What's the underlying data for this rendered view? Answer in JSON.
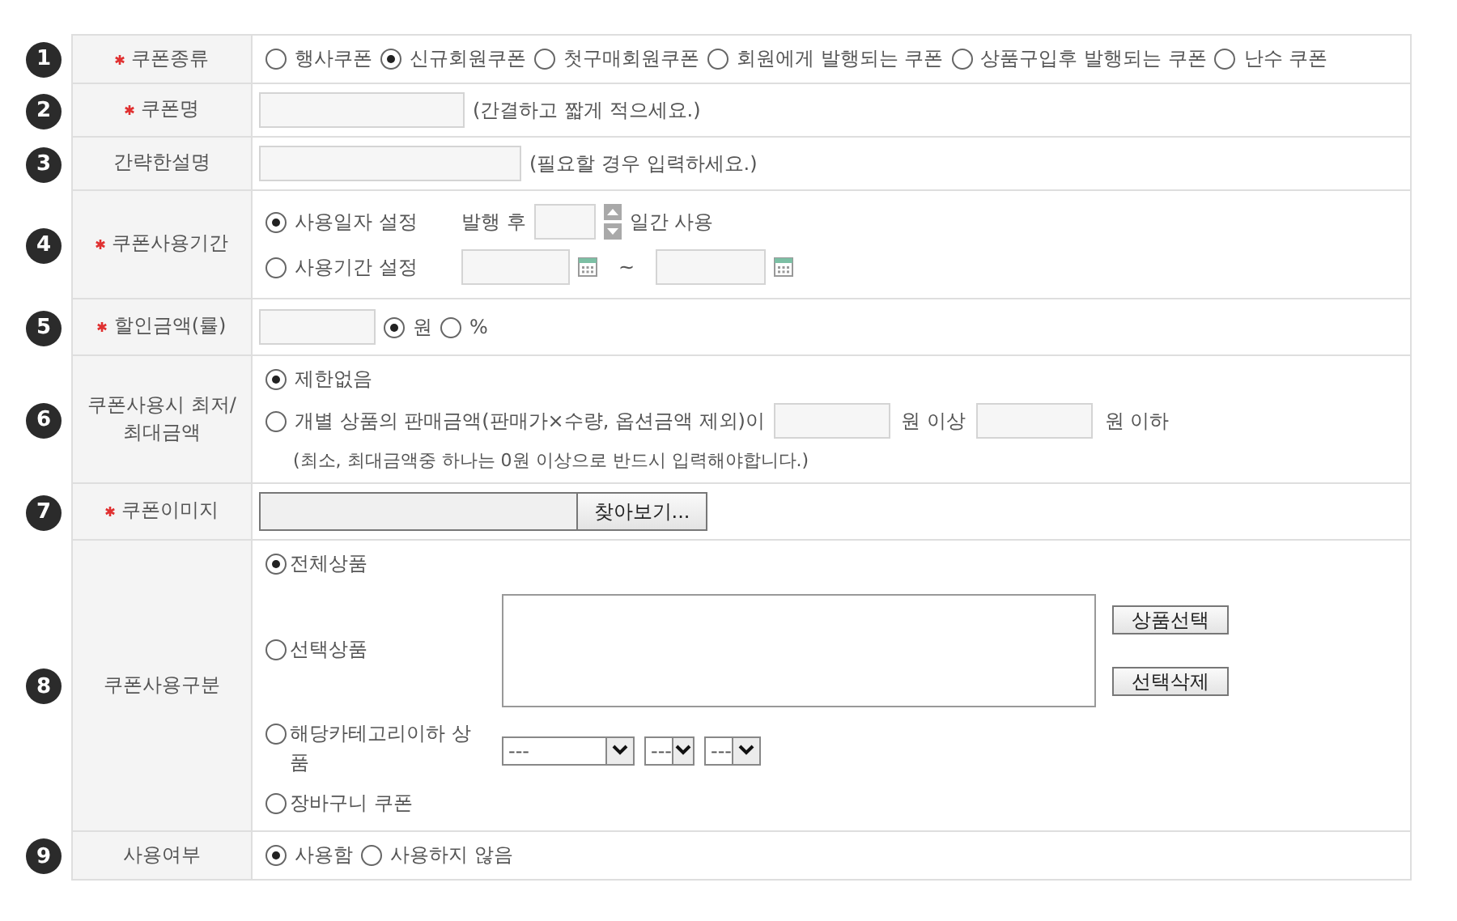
{
  "rows": [
    {
      "number": "1",
      "label": "쿠폰종류",
      "required": true,
      "kind": "radios",
      "options": [
        {
          "label": "행사쿠폰",
          "selected": false
        },
        {
          "label": "신규회원쿠폰",
          "selected": true
        },
        {
          "label": "첫구매회원쿠폰",
          "selected": false
        },
        {
          "label": "회원에게 발행되는 쿠폰",
          "selected": false
        },
        {
          "label": "상품구입후 발행되는 쿠폰",
          "selected": false
        },
        {
          "label": "난수 쿠폰",
          "selected": false
        }
      ]
    },
    {
      "number": "2",
      "label": "쿠폰명",
      "required": true,
      "kind": "short_text",
      "hint": "(간결하고 짧게 적으세요.)"
    },
    {
      "number": "3",
      "label": "간략한설명",
      "required": false,
      "kind": "long_text",
      "hint": "(필요할 경우 입력하세요.)"
    },
    {
      "number": "4",
      "label": "쿠폰사용기간",
      "required": true,
      "kind": "period",
      "days_option": {
        "label": "사용일자 설정",
        "selected": true,
        "prefix": "발행 후",
        "suffix": "일간 사용"
      },
      "range_option": {
        "label": "사용기간 설정",
        "selected": false,
        "separator": "~"
      }
    },
    {
      "number": "5",
      "label": "할인금액(률)",
      "required": true,
      "kind": "amount",
      "options": [
        {
          "label": "원",
          "selected": true
        },
        {
          "label": "%",
          "selected": false
        }
      ]
    },
    {
      "number": "6",
      "label": "쿠폰사용시 최저/최대금액",
      "required": false,
      "kind": "limits",
      "none_option": {
        "label": "제한없음",
        "selected": true
      },
      "range_option": {
        "label": "개별 상품의 판매금액(판매가×수량, 옵션금액 제외)이",
        "selected": false,
        "min_suffix": "원 이상",
        "max_suffix": "원 이하"
      },
      "note": "(최소, 최대금액중 하나는 0원 이상으로 반드시 입력해야합니다.)"
    },
    {
      "number": "7",
      "label": "쿠폰이미지",
      "required": true,
      "kind": "file",
      "button": "찾아보기..."
    },
    {
      "number": "8",
      "label": "쿠폰사용구분",
      "required": false,
      "kind": "scope",
      "options": [
        {
          "kind": "plain",
          "label": "전체상품",
          "selected": true
        },
        {
          "kind": "products",
          "label": "선택상품",
          "selected": false,
          "buttons": [
            "상품선택",
            "선택삭제"
          ]
        },
        {
          "kind": "category",
          "label": "해당카테고리이하 상품",
          "selected": false,
          "selects": [
            "---",
            "---",
            "---"
          ]
        },
        {
          "kind": "plain",
          "label": "장바구니 쿠폰",
          "selected": false
        }
      ]
    },
    {
      "number": "9",
      "label": "사용여부",
      "required": false,
      "kind": "radios",
      "options": [
        {
          "label": "사용함",
          "selected": true
        },
        {
          "label": "사용하지 않음",
          "selected": false
        }
      ]
    }
  ]
}
